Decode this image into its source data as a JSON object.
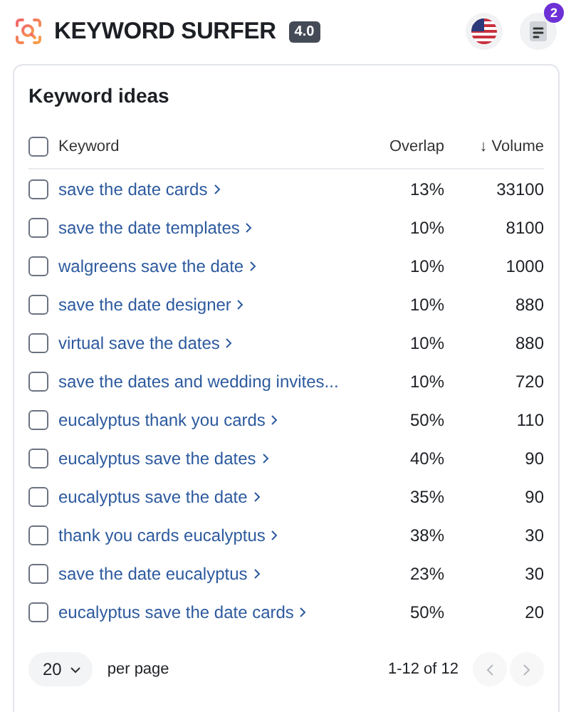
{
  "app": {
    "name": "KEYWORD SURFER",
    "version": "4.0",
    "notification_count": "2"
  },
  "card": {
    "title": "Keyword ideas",
    "columns": {
      "select_all_checked": false,
      "keyword": "Keyword",
      "overlap": "Overlap",
      "volume": "Volume",
      "sort_arrow": "↓"
    },
    "rows": [
      {
        "keyword": "save the date cards",
        "chevron": true,
        "checked": false,
        "overlap": "13%",
        "volume": "33100"
      },
      {
        "keyword": "save the date templates",
        "chevron": true,
        "checked": false,
        "overlap": "10%",
        "volume": "8100"
      },
      {
        "keyword": "walgreens save the date",
        "chevron": true,
        "checked": false,
        "overlap": "10%",
        "volume": "1000"
      },
      {
        "keyword": "save the date designer",
        "chevron": true,
        "checked": false,
        "overlap": "10%",
        "volume": "880"
      },
      {
        "keyword": "virtual save the dates",
        "chevron": true,
        "checked": false,
        "overlap": "10%",
        "volume": "880"
      },
      {
        "keyword": "save the dates and wedding invites...",
        "chevron": false,
        "checked": false,
        "overlap": "10%",
        "volume": "720"
      },
      {
        "keyword": "eucalyptus thank you cards",
        "chevron": true,
        "checked": false,
        "overlap": "50%",
        "volume": "110"
      },
      {
        "keyword": "eucalyptus save the dates",
        "chevron": true,
        "checked": false,
        "overlap": "40%",
        "volume": "90"
      },
      {
        "keyword": "eucalyptus save the date",
        "chevron": true,
        "checked": false,
        "overlap": "35%",
        "volume": "90"
      },
      {
        "keyword": "thank you cards eucalyptus",
        "chevron": true,
        "checked": false,
        "overlap": "38%",
        "volume": "30"
      },
      {
        "keyword": "save the date eucalyptus",
        "chevron": true,
        "checked": false,
        "overlap": "23%",
        "volume": "30"
      },
      {
        "keyword": "eucalyptus save the date cards",
        "chevron": true,
        "checked": false,
        "overlap": "50%",
        "volume": "20"
      }
    ],
    "pagination": {
      "page_size": "20",
      "per_page_label": "per page",
      "range": "1-12 of 12",
      "prev_disabled": true,
      "next_disabled": true
    }
  }
}
